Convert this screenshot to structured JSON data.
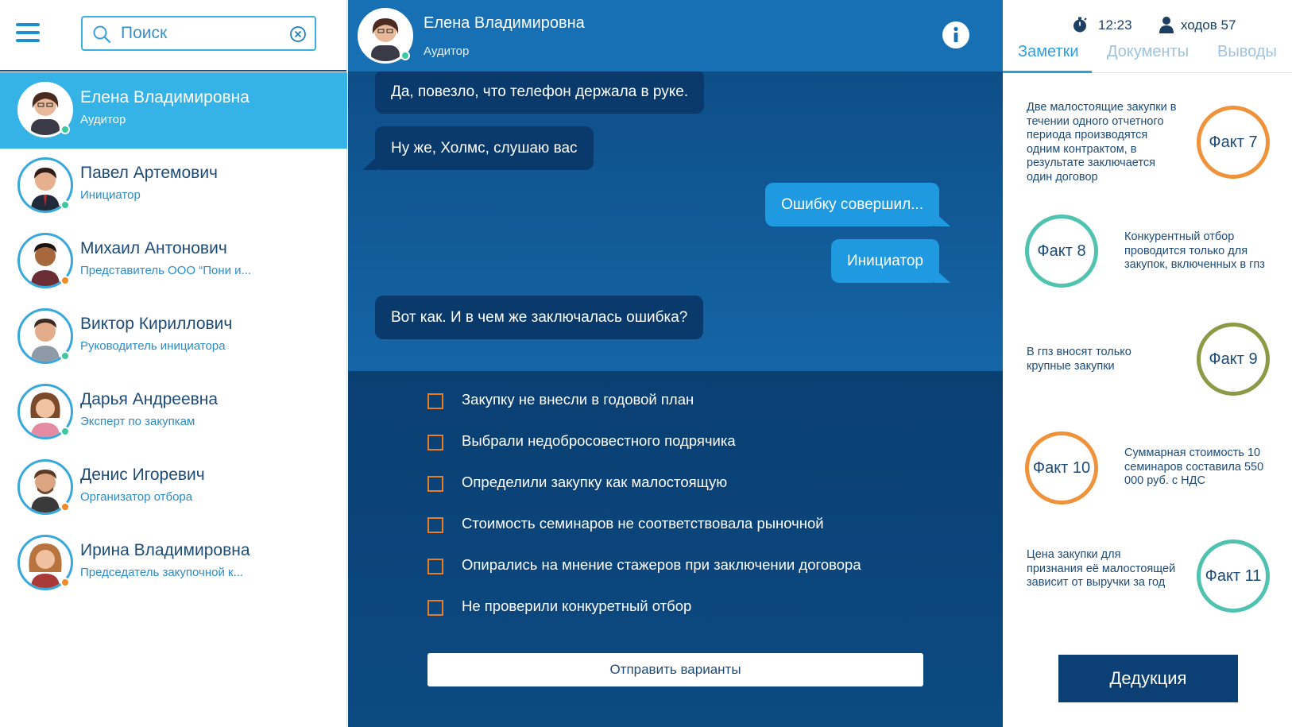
{
  "sidebar": {
    "search_placeholder": "Поиск",
    "contacts": [
      {
        "name": "Елена Владимировна",
        "role": "Аудитор",
        "status_color": "#3cc8a0",
        "active": true
      },
      {
        "name": "Павел Артемович",
        "role": "Инициатор",
        "status_color": "#3cc8a0"
      },
      {
        "name": "Михаил Антонович",
        "role": "Представитель ООО “Пони и...",
        "status_color": "#f08a24"
      },
      {
        "name": "Виктор Кириллович",
        "role": "Руководитель инициатора",
        "status_color": "#3cc8a0"
      },
      {
        "name": "Дарья Андреевна",
        "role": "Эксперт по закупкам",
        "status_color": "#3cc8a0"
      },
      {
        "name": "Денис Игоревич",
        "role": "Организатор отбора",
        "status_color": "#f08a24"
      },
      {
        "name": "Ирина Владимировна",
        "role": "Председатель закупочной к...",
        "status_color": "#f08a24"
      }
    ]
  },
  "chat": {
    "header": {
      "name": "Елена Владимировна",
      "role": "Аудитор"
    },
    "messages": [
      {
        "text": "Да, повезло, что телефон держала в руке.",
        "direction": "in"
      },
      {
        "text": "Ну же, Холмс, слушаю вас",
        "direction": "in"
      },
      {
        "text": "Ошибку совершил...",
        "direction": "out"
      },
      {
        "text": "Инициатор",
        "direction": "out"
      },
      {
        "text": "Вот как. И в чем же заключалась ошибка?",
        "direction": "in"
      }
    ],
    "options": [
      "Закупку не внесли в годовой план",
      "Выбрали недобросовестного подрячика",
      "Определили закупку как малостоящую",
      "Стоимость семинаров не соответствовала рыночной",
      "Опирались на мнение стажеров при заключении договора",
      "Не проверили конкуретный отбор"
    ],
    "submit_label": "Отправить варианты"
  },
  "right_panel": {
    "time": "12:23",
    "moves": "ходов 57",
    "tabs": [
      "Заметки",
      "Документы",
      "Выводы"
    ],
    "active_tab": "Заметки",
    "facts": [
      {
        "label": "Факт 7",
        "text": "Две малостоящие закупки в течении одного отчетного периода производятся одним контрактом, в результате заключается один договор",
        "color": "#f0923a"
      },
      {
        "label": "Факт 8",
        "text": "Конкурентный отбор проводится только для закупок, включенных в гпз",
        "color": "#4fc2b0"
      },
      {
        "label": "Факт 9",
        "text": "В гпз вносят только крупные закупки",
        "color": "#8a9a45"
      },
      {
        "label": "Факт 10",
        "text": "Суммарная стоимость 10 семинаров составила 550 000 руб. с НДС",
        "color": "#f0923a"
      },
      {
        "label": "Факт 11",
        "text": "Цена закупки для признания её малостоящей зависит от выручки за год",
        "color": "#4fc2b0"
      }
    ],
    "deduce_label": "Дедукция"
  }
}
